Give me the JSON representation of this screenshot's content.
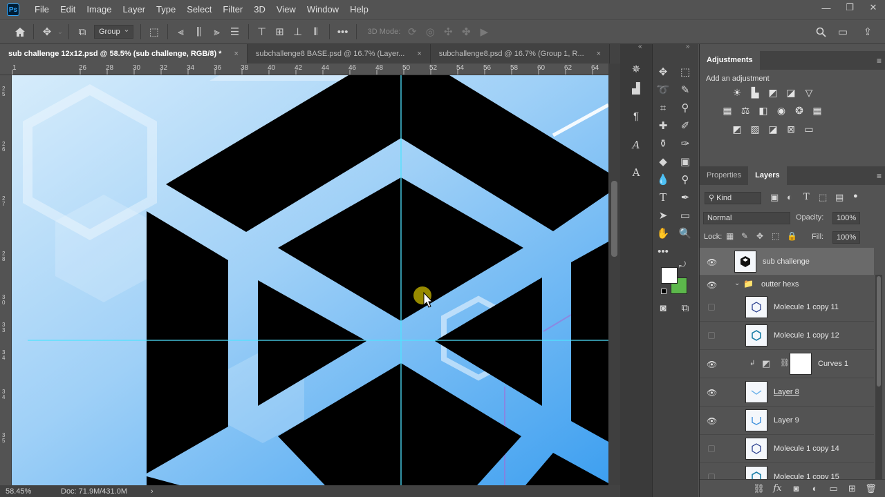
{
  "menu": {
    "logo": "Ps",
    "items": [
      "File",
      "Edit",
      "Image",
      "Layer",
      "Type",
      "Select",
      "Filter",
      "3D",
      "View",
      "Window",
      "Help"
    ]
  },
  "window_controls": [
    "—",
    "❐",
    "✕"
  ],
  "options": {
    "auto_select_target": "Group",
    "mode_3d_label": "3D Mode:"
  },
  "tabs": [
    {
      "label": "sub challenge 12x12.psd @ 58.5% (sub challenge, RGB/8) *",
      "close": "×"
    },
    {
      "label": "subchallenge8 BASE.psd @ 16.7% (Layer...",
      "close": "×"
    },
    {
      "label": "subchallenge8.psd @ 16.7% (Group 1, R...",
      "close": "×"
    }
  ],
  "ruler": {
    "top_ticks": [
      "1",
      "26",
      "28",
      "30",
      "32",
      "34",
      "36",
      "38",
      "40",
      "42",
      "44",
      "46",
      "48",
      "50",
      "52",
      "54",
      "56",
      "58",
      "60",
      "62",
      "64"
    ],
    "left_ticks": [
      "2 5",
      "2 6",
      "2 7",
      "2 8",
      "3 0",
      "3 3",
      "3 4",
      "3 4",
      "3 5"
    ]
  },
  "status": {
    "zoom": "58.45%",
    "doc": "Doc: 71.9M/431.0M",
    "arrow": "›"
  },
  "adjustments": {
    "title": "Adjustments",
    "subtitle": "Add an adjustment"
  },
  "layers_panel": {
    "tabs": [
      "Properties",
      "Layers"
    ],
    "filter_kind": "Kind",
    "blend_mode": "Normal",
    "opacity_label": "Opacity:",
    "opacity_value": "100%",
    "lock_label": "Lock:",
    "fill_label": "Fill:",
    "fill_value": "100%",
    "layers": [
      {
        "name": "sub challenge",
        "visible": true,
        "selected": true
      },
      {
        "name": "outter hexs",
        "visible": true,
        "group": true
      },
      {
        "name": "Molecule 1 copy 11",
        "visible": false
      },
      {
        "name": "Molecule 1 copy 12",
        "visible": false
      },
      {
        "name": "Curves 1",
        "visible": true
      },
      {
        "name": "Layer 8",
        "visible": true
      },
      {
        "name": "Layer 9",
        "visible": true
      },
      {
        "name": "Molecule 1 copy 14",
        "visible": false
      },
      {
        "name": "Molecule 1 copy 15",
        "visible": false
      }
    ]
  },
  "colors": {
    "foreground": "#ffffff",
    "background": "#5cb84b",
    "canvas_blue": "#7cc0f5",
    "guide": "#4fe3ff"
  }
}
